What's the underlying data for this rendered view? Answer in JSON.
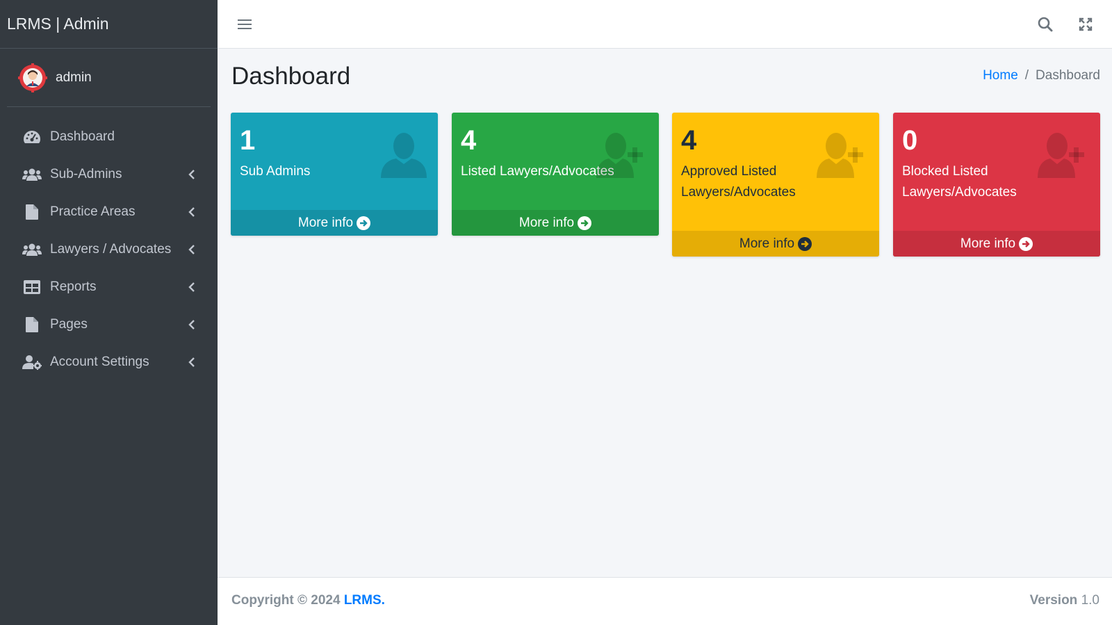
{
  "brand": {
    "title": "LRMS | Admin"
  },
  "user": {
    "name": "admin",
    "avatar_icon": "admin-avatar-icon"
  },
  "sidebar": {
    "items": [
      {
        "label": "Dashboard",
        "icon": "tachometer-icon",
        "has_submenu": false
      },
      {
        "label": "Sub-Admins",
        "icon": "users-icon",
        "has_submenu": true
      },
      {
        "label": "Practice Areas",
        "icon": "file-icon",
        "has_submenu": true
      },
      {
        "label": "Lawyers / Advocates",
        "icon": "users-icon",
        "has_submenu": true
      },
      {
        "label": "Reports",
        "icon": "table-icon",
        "has_submenu": true
      },
      {
        "label": "Pages",
        "icon": "file-icon",
        "has_submenu": true
      },
      {
        "label": "Account Settings",
        "icon": "user-cog-icon",
        "has_submenu": true
      }
    ]
  },
  "navbar": {
    "menu_icon": "hamburger-icon",
    "search_icon": "search-icon",
    "fullscreen_icon": "expand-icon"
  },
  "header": {
    "title": "Dashboard",
    "breadcrumb": {
      "home": "Home",
      "separator": "/",
      "current": "Dashboard"
    }
  },
  "boxes": [
    {
      "count": "1",
      "label": "Sub Admins",
      "footer": "More info",
      "icon": "user-icon",
      "color": "#17a2b8"
    },
    {
      "count": "4",
      "label": "Listed Lawyers/Advocates",
      "footer": "More info",
      "icon": "user-plus-icon",
      "color": "#28a745"
    },
    {
      "count": "4",
      "label": "Approved Listed Lawyers/Advocates",
      "footer": "More info",
      "icon": "user-plus-icon",
      "color": "#ffc107"
    },
    {
      "count": "0",
      "label": "Blocked Listed Lawyers/Advocates",
      "footer": "More info",
      "icon": "user-plus-icon",
      "color": "#dc3545"
    }
  ],
  "footer": {
    "copyright": "Copyright © 2024 ",
    "brand": "LRMS.",
    "version_label": "Version",
    "version": "1.0"
  }
}
